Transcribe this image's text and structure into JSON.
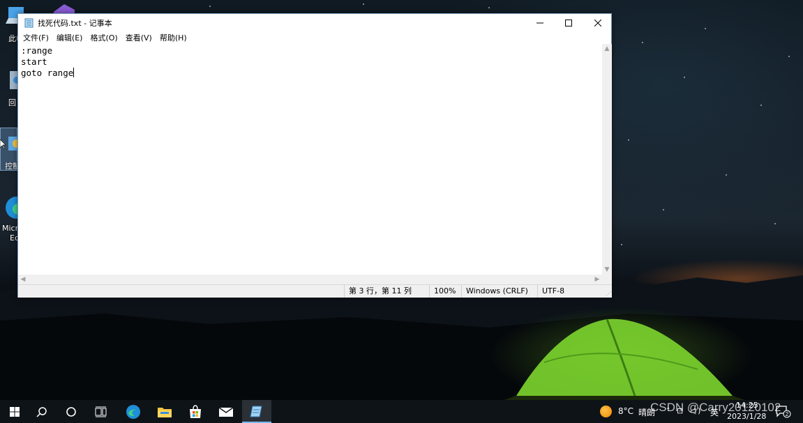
{
  "desktop": {
    "icons": [
      {
        "label": "此电"
      },
      {
        "label": "回"
      },
      {
        "label": "控制"
      },
      {
        "label": "Micro"
      },
      {
        "label": "Ed"
      }
    ]
  },
  "window": {
    "title": "找死代码.txt - 记事本",
    "menu": [
      "文件(F)",
      "编辑(E)",
      "格式(O)",
      "查看(V)",
      "帮助(H)"
    ],
    "content_lines": [
      ":range",
      "start",
      "goto range"
    ],
    "status": {
      "position": "第 3 行，第 11 列",
      "zoom": "100%",
      "line_ending": "Windows (CRLF)",
      "encoding": "UTF-8"
    }
  },
  "taskbar": {
    "weather_temp": "8°C",
    "weather_condition": "晴朗",
    "language": "英",
    "clock_time": "14:25",
    "clock_date": "2023/1/28",
    "notification_count": "2"
  },
  "watermark": "CSDN @Carry20120102",
  "colors": {
    "taskbar": "#0e1318",
    "active_indicator": "#76b9ed",
    "tent_green": "#7bd12e"
  }
}
